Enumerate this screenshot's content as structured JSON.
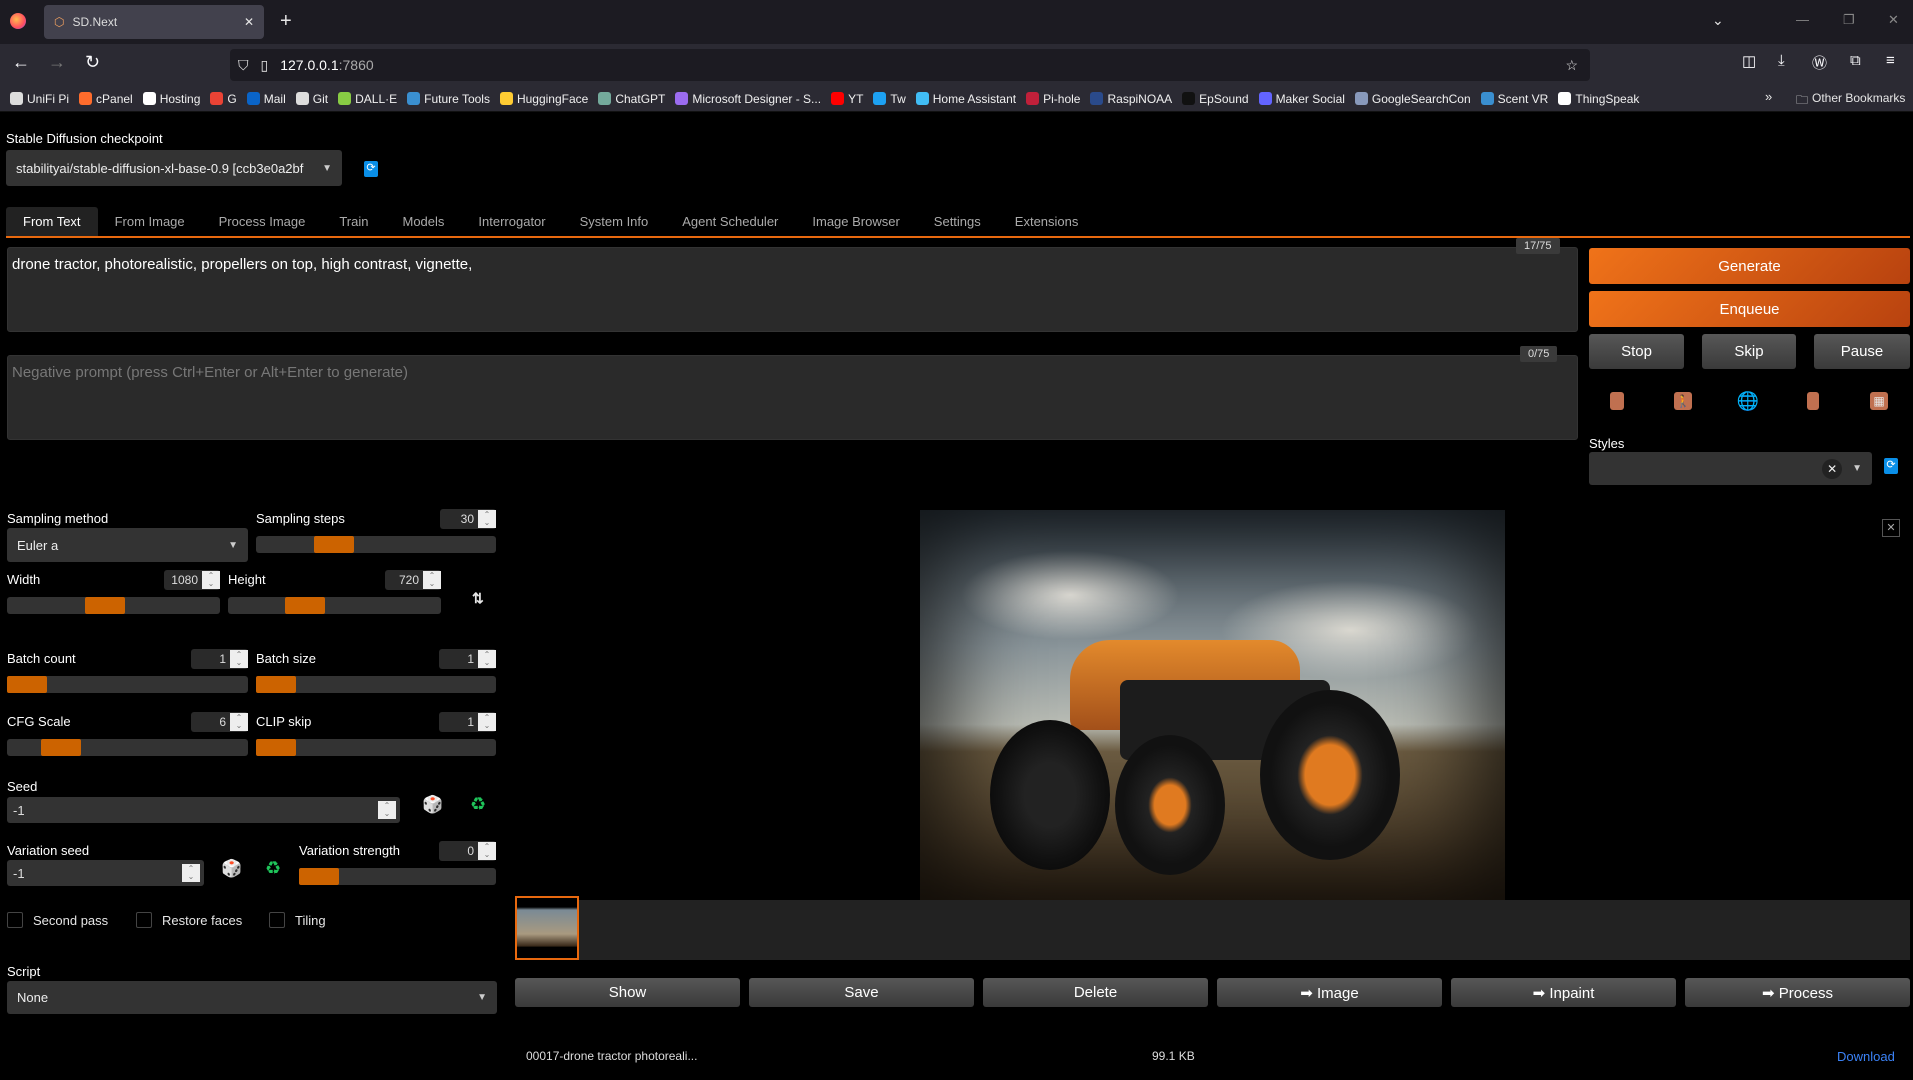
{
  "browser": {
    "tab_title": "SD.Next",
    "url_host": "127.0.0.1",
    "url_port": ":7860",
    "bookmarks": [
      {
        "label": "UniFi Pi",
        "color": "#dddddd"
      },
      {
        "label": "cPanel",
        "color": "#ff6c2c"
      },
      {
        "label": "Hosting",
        "color": "#ffffff"
      },
      {
        "label": "G",
        "color": "#ea4335"
      },
      {
        "label": "Mail",
        "color": "#0a64c8"
      },
      {
        "label": "Git",
        "color": "#dddddd"
      },
      {
        "label": "DALL·E",
        "color": "#88cc44"
      },
      {
        "label": "Future Tools",
        "color": "#3a8fd0"
      },
      {
        "label": "HuggingFace",
        "color": "#ffcc33"
      },
      {
        "label": "ChatGPT",
        "color": "#74aa9c"
      },
      {
        "label": "Microsoft Designer - S...",
        "color": "#9b6cf0"
      },
      {
        "label": "YT",
        "color": "#ff0000"
      },
      {
        "label": "Tw",
        "color": "#1da1f2"
      },
      {
        "label": "Home Assistant",
        "color": "#41bdf5"
      },
      {
        "label": "Pi-hole",
        "color": "#c0203a"
      },
      {
        "label": "RaspiNOAA",
        "color": "#2a4a8a"
      },
      {
        "label": "EpSound",
        "color": "#111111"
      },
      {
        "label": "Maker Social",
        "color": "#6364ff"
      },
      {
        "label": "GoogleSearchCon",
        "color": "#8899bb"
      },
      {
        "label": "Scent VR",
        "color": "#3a8fd0"
      },
      {
        "label": "ThingSpeak",
        "color": "#ffffff"
      }
    ],
    "other_bookmarks": "Other Bookmarks"
  },
  "checkpoint": {
    "label": "Stable Diffusion checkpoint",
    "value": "stabilityai/stable-diffusion-xl-base-0.9 [ccb3e0a2bf"
  },
  "tabs": [
    "From Text",
    "From Image",
    "Process Image",
    "Train",
    "Models",
    "Interrogator",
    "System Info",
    "Agent Scheduler",
    "Image Browser",
    "Settings",
    "Extensions"
  ],
  "active_tab": "From Text",
  "prompt": {
    "value": "drone tractor, photorealistic, propellers on top, high contrast, vignette,",
    "counter": "17/75"
  },
  "negative_prompt": {
    "placeholder": "Negative prompt (press Ctrl+Enter or Alt+Enter to generate)",
    "counter": "0/75"
  },
  "actions": {
    "generate": "Generate",
    "enqueue": "Enqueue",
    "stop": "Stop",
    "skip": "Skip",
    "pause": "Pause"
  },
  "styles": {
    "label": "Styles",
    "value": ""
  },
  "params": {
    "sampling_method": {
      "label": "Sampling method",
      "value": "Euler a"
    },
    "sampling_steps": {
      "label": "Sampling steps",
      "value": "30",
      "fraction": 0.29
    },
    "width": {
      "label": "Width",
      "value": "1080",
      "fraction": 0.45
    },
    "height": {
      "label": "Height",
      "value": "720",
      "fraction": 0.33
    },
    "batch_count": {
      "label": "Batch count",
      "value": "1",
      "fraction": 0
    },
    "batch_size": {
      "label": "Batch size",
      "value": "1",
      "fraction": 0
    },
    "cfg_scale": {
      "label": "CFG Scale",
      "value": "6",
      "fraction": 0.17
    },
    "clip_skip": {
      "label": "CLIP skip",
      "value": "1",
      "fraction": 0
    },
    "seed": {
      "label": "Seed",
      "value": "-1"
    },
    "variation_seed": {
      "label": "Variation seed",
      "value": "-1"
    },
    "variation_strength": {
      "label": "Variation strength",
      "value": "0",
      "fraction": 0
    },
    "checkboxes": {
      "second_pass": "Second pass",
      "restore_faces": "Restore faces",
      "tiling": "Tiling"
    },
    "script": {
      "label": "Script",
      "value": "None"
    }
  },
  "gallery": {
    "buttons": [
      "Show",
      "Save",
      "Delete",
      "➡ Image",
      "➡ Inpaint",
      "➡ Process"
    ],
    "filename": "00017-drone tractor photoreali...",
    "filesize": "99.1 KB",
    "download": "Download"
  },
  "colors": {
    "accent": "#e8690f",
    "link": "#3b82f6"
  }
}
